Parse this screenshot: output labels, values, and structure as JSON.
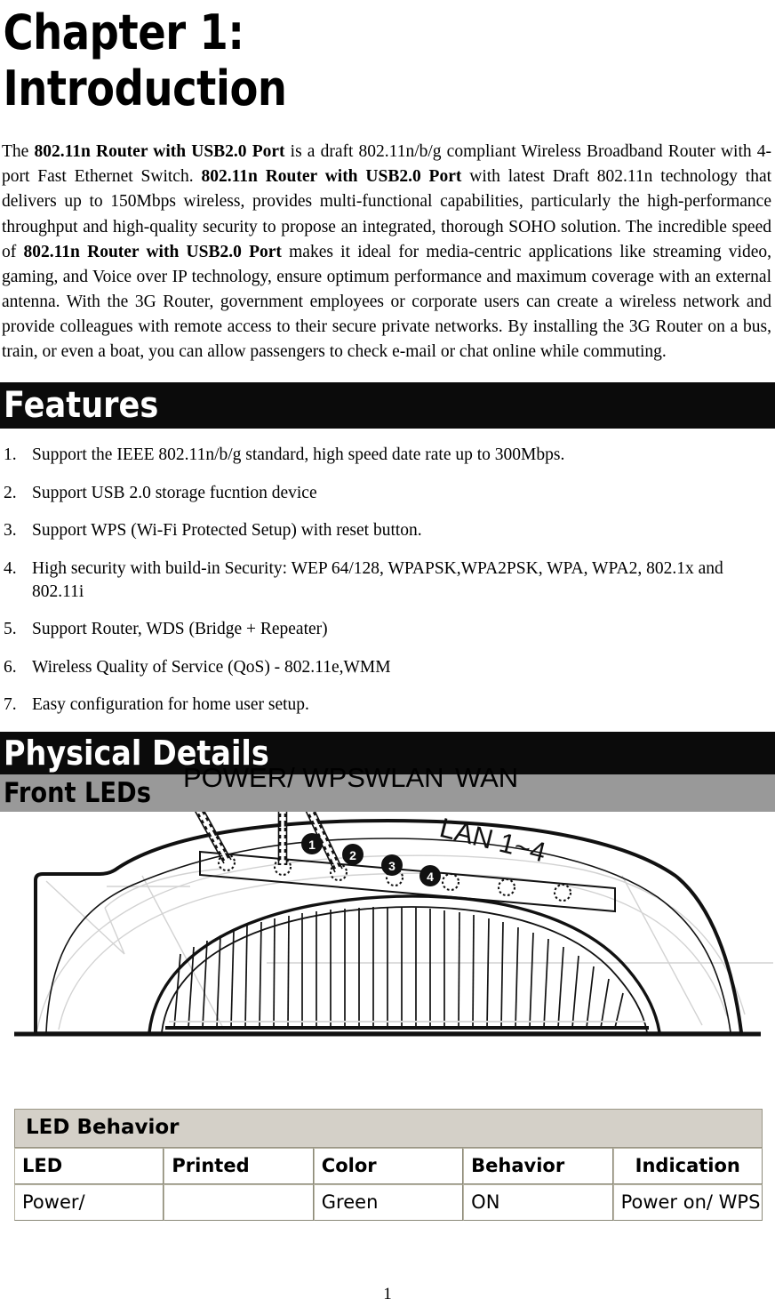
{
  "document": {
    "chapter_title_line1": "Chapter 1:",
    "chapter_title_line2": "Introduction",
    "page_number": "1"
  },
  "intro": {
    "p1_seg1": "The ",
    "p1_bold1": "802.11n Router with USB2.0 Port",
    "p1_seg2": " is a draft 802.11n/b/g compliant Wireless Broadband Router with 4-port Fast Ethernet Switch. ",
    "p1_bold2": "802.11n Router with USB2.0 Port",
    "p1_seg3": " with latest Draft 802.11n technology that delivers up to 150Mbps wireless, provides multi-functional capabilities, particularly the high-performance throughput and high-quality security to propose an integrated, thorough SOHO solution. The incredible speed of ",
    "p1_bold3": "802.11n Router with USB2.0 Port",
    "p1_seg4": " makes it ideal for media-centric applications like streaming video, gaming, and Voice over IP technology, ensure optimum performance and maximum coverage with an external antenna. With the 3G Router, government employees or corporate users can create a wireless network and provide colleagues with remote access to their secure private networks. By installing the 3G Router on a bus, train, or even a boat, you can allow passengers to check e-mail or chat online while commuting."
  },
  "sections": {
    "features_heading": "Features",
    "physical_details_heading": "Physical Details",
    "front_leds_heading": "Front LEDs"
  },
  "features": {
    "items": [
      {
        "num": "1.",
        "text": "Support the IEEE 802.11n/b/g standard, high speed date rate up to 300Mbps."
      },
      {
        "num": "2.",
        "text": "Support USB 2.0 storage fucntion device"
      },
      {
        "num": "3.",
        "text": "Support WPS (Wi-Fi Protected Setup) with reset button."
      },
      {
        "num": "4.",
        "text": "High security with build-in Security: WEP 64/128, WPAPSK,WPA2PSK, WPA, WPA2, 802.1x and 802.11i"
      },
      {
        "num": "5.",
        "text": "Support Router, WDS (Bridge + Repeater)"
      },
      {
        "num": "6.",
        "text": "Wireless Quality of Service (QoS) - 802.11e,WMM"
      },
      {
        "num": "7.",
        "text": "Easy configuration for home user setup."
      }
    ]
  },
  "router_diagram": {
    "labels": {
      "power_wps": "POWER/ WPS",
      "wlan": "WLAN",
      "wan": "WAN",
      "lan": "LAN 1~4"
    },
    "lan_badges": [
      "1",
      "2",
      "3",
      "4"
    ],
    "led_count": 7,
    "line_color": "#000000",
    "construction_line_color": "#cfcfcf"
  },
  "led_table": {
    "title": "LED Behavior",
    "columns": [
      "LED",
      "Printed",
      "Color",
      "Behavior",
      "Indication"
    ],
    "rows": [
      {
        "led": "Power/",
        "printed": "",
        "color": "Green",
        "behavior": "ON",
        "indication": "Power on/ WPS function active"
      }
    ]
  }
}
